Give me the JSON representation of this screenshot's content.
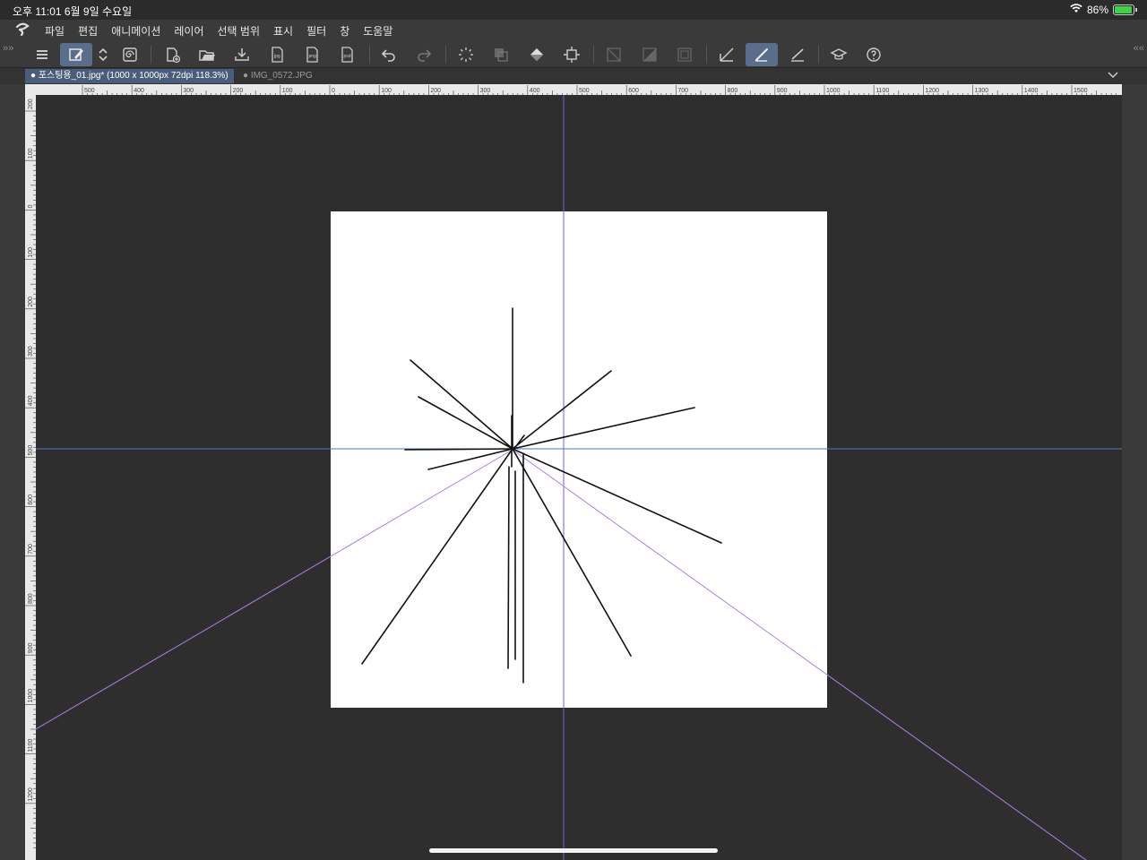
{
  "status_bar": {
    "time": "오후 11:01   6월 9일 수요일",
    "battery": "86%",
    "battery_level": 0.86
  },
  "menu": [
    "파일",
    "편집",
    "애니메이션",
    "레이어",
    "선택 범위",
    "표시",
    "필터",
    "창",
    "도움말"
  ],
  "toolbar_icons": [
    "menu-icon",
    "pen-edit-icon",
    "chevron-updown-icon",
    "swirl-icon",
    "new-file-icon",
    "open-folder-icon",
    "save-icon",
    "export-jpg-icon",
    "export-png-icon",
    "export-psd-icon",
    "undo-icon",
    "redo-icon",
    "loading-icon",
    "transparent-icon",
    "fill-icon",
    "transform-icon",
    "clear-icon",
    "tone-icon",
    "frame-icon",
    "ruler-icon",
    "brush-icon",
    "straight-line-icon",
    "learn-icon",
    "help-icon"
  ],
  "tabs": [
    {
      "label": "포스팅용_01.jpg* (1000 x 1000px 72dpi 118.3%)",
      "active": true
    },
    {
      "label": "IMG_0572.JPG",
      "active": false
    }
  ],
  "ruler_h_labels": [
    "500",
    "400",
    "300",
    "200",
    "100",
    "0",
    "100",
    "200",
    "300",
    "400",
    "500",
    "600",
    "700",
    "800",
    "900",
    "1000",
    "1100",
    "1200",
    "1300",
    "1400",
    "1500"
  ],
  "ruler_v_labels": [
    "200",
    "100",
    "0",
    "100",
    "200",
    "300",
    "400",
    "500",
    "600",
    "700",
    "800",
    "900",
    "1000",
    "1100",
    "1200"
  ],
  "colors": {
    "guide_horizontal": "#4a78b8",
    "guide_vertical": "#7b5fc9",
    "perspective_guide": "#b07ee6",
    "stroke": "#111111",
    "active_tool": "#5a6e8c"
  }
}
